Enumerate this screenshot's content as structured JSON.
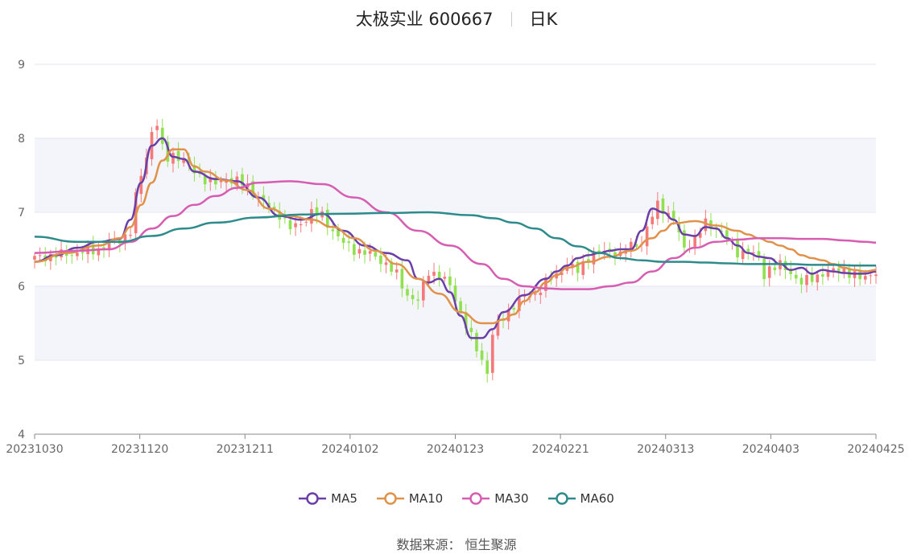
{
  "title": {
    "name": "太极实业 600667",
    "period": "日K"
  },
  "source": {
    "label": "数据来源：",
    "value": "恒生聚源"
  },
  "colors": {
    "up": "#f47a7a",
    "down": "#90e050",
    "grid_band": "#f4f5fb",
    "axis": "#666666"
  },
  "chart_data": {
    "type": "candlestick",
    "title": "太极实业 600667 日K",
    "ylim": [
      4,
      9
    ],
    "y_ticks": [
      4,
      5,
      6,
      7,
      8,
      9
    ],
    "x_tick_labels": [
      "20231030",
      "20231120",
      "20231211",
      "20240102",
      "20240123",
      "20240221",
      "20240313",
      "20240403",
      "20240425"
    ],
    "legend_position": "bottom",
    "series": [
      {
        "name": "MA5",
        "color": "#6a3fa8",
        "x": [
          0,
          4,
          8,
          12,
          16,
          18,
          20,
          22,
          24,
          26,
          28,
          30,
          34,
          38,
          42,
          46,
          50,
          54,
          58,
          62,
          66,
          70,
          72,
          74,
          76,
          78,
          80,
          82,
          84,
          86,
          88,
          92,
          96,
          98,
          100,
          102,
          104,
          106,
          108,
          110,
          112,
          114,
          116,
          118,
          120,
          122,
          124,
          126,
          128,
          130,
          132,
          134,
          136,
          138,
          140,
          142,
          144,
          146,
          148,
          150,
          152,
          154,
          156,
          158
        ],
        "values": [
          6.33,
          6.42,
          6.52,
          6.6,
          6.64,
          6.9,
          7.4,
          7.9,
          8.0,
          7.75,
          7.72,
          7.55,
          7.45,
          7.42,
          7.2,
          6.95,
          6.9,
          6.98,
          6.75,
          6.55,
          6.45,
          6.35,
          6.1,
          6.05,
          6.1,
          5.92,
          5.6,
          5.3,
          5.3,
          5.42,
          5.65,
          5.88,
          6.1,
          6.2,
          6.28,
          6.38,
          6.42,
          6.45,
          6.48,
          6.5,
          6.5,
          6.75,
          7.05,
          7.0,
          6.9,
          6.7,
          6.68,
          6.8,
          6.78,
          6.65,
          6.55,
          6.45,
          6.4,
          6.38,
          6.3,
          6.22,
          6.25,
          6.17,
          6.22,
          6.2,
          6.18,
          6.17,
          6.17,
          6.2
        ]
      },
      {
        "name": "MA10",
        "color": "#e0924a",
        "x": [
          0,
          6,
          12,
          16,
          18,
          20,
          22,
          24,
          26,
          28,
          30,
          32,
          36,
          40,
          44,
          48,
          52,
          56,
          60,
          64,
          68,
          72,
          76,
          80,
          84,
          86,
          88,
          90,
          92,
          94,
          96,
          98,
          100,
          104,
          108,
          112,
          116,
          118,
          120,
          124,
          128,
          132,
          134,
          136,
          138,
          140,
          142,
          144,
          146,
          148,
          150,
          152,
          154,
          156,
          158
        ],
        "values": [
          6.33,
          6.45,
          6.55,
          6.65,
          6.8,
          7.1,
          7.4,
          7.7,
          7.85,
          7.85,
          7.62,
          7.55,
          7.43,
          7.3,
          7.05,
          6.95,
          6.9,
          6.8,
          6.65,
          6.48,
          6.3,
          6.1,
          5.9,
          5.65,
          5.5,
          5.5,
          5.55,
          5.62,
          5.8,
          5.92,
          6.05,
          6.15,
          6.25,
          6.33,
          6.4,
          6.48,
          6.65,
          6.75,
          6.85,
          6.88,
          6.82,
          6.75,
          6.7,
          6.65,
          6.6,
          6.55,
          6.5,
          6.42,
          6.38,
          6.35,
          6.3,
          6.25,
          6.22,
          6.2,
          6.22
        ]
      },
      {
        "name": "MA30",
        "color": "#d65db1",
        "x": [
          0,
          8,
          14,
          18,
          22,
          26,
          30,
          34,
          38,
          42,
          48,
          54,
          60,
          66,
          72,
          78,
          84,
          88,
          92,
          96,
          100,
          104,
          108,
          112,
          116,
          120,
          124,
          128,
          132,
          136,
          140,
          144,
          148,
          152,
          156,
          158
        ],
        "values": [
          6.45,
          6.48,
          6.5,
          6.6,
          6.78,
          6.95,
          7.1,
          7.22,
          7.33,
          7.4,
          7.42,
          7.38,
          7.2,
          7.0,
          6.75,
          6.55,
          6.3,
          6.1,
          6.0,
          5.97,
          5.96,
          5.96,
          6.0,
          6.05,
          6.2,
          6.38,
          6.52,
          6.6,
          6.63,
          6.65,
          6.65,
          6.64,
          6.64,
          6.62,
          6.6,
          6.59
        ]
      },
      {
        "name": "MA60",
        "color": "#2e8b8b",
        "x": [
          0,
          8,
          16,
          22,
          28,
          34,
          42,
          50,
          58,
          66,
          74,
          82,
          86,
          90,
          94,
          98,
          102,
          106,
          110,
          114,
          118,
          122,
          126,
          130,
          134,
          138,
          142,
          146,
          150,
          154,
          158
        ],
        "values": [
          6.67,
          6.6,
          6.6,
          6.68,
          6.78,
          6.86,
          6.93,
          6.97,
          6.98,
          6.99,
          7.0,
          6.96,
          6.92,
          6.86,
          6.78,
          6.65,
          6.54,
          6.45,
          6.38,
          6.35,
          6.33,
          6.33,
          6.32,
          6.31,
          6.3,
          6.3,
          6.3,
          6.29,
          6.29,
          6.28,
          6.28
        ]
      }
    ],
    "candles": {
      "count": 159,
      "anchors": [
        [
          0,
          6.38
        ],
        [
          4,
          6.42
        ],
        [
          8,
          6.45
        ],
        [
          12,
          6.5
        ],
        [
          14,
          6.58
        ],
        [
          16,
          6.62
        ],
        [
          18,
          6.75
        ],
        [
          19,
          7.2
        ],
        [
          20,
          7.5
        ],
        [
          21,
          7.75
        ],
        [
          22,
          8.1
        ],
        [
          23,
          8.2
        ],
        [
          24,
          7.85
        ],
        [
          25,
          7.72
        ],
        [
          26,
          7.78
        ],
        [
          27,
          7.75
        ],
        [
          28,
          7.7
        ],
        [
          30,
          7.55
        ],
        [
          32,
          7.45
        ],
        [
          34,
          7.38
        ],
        [
          36,
          7.45
        ],
        [
          38,
          7.42
        ],
        [
          40,
          7.35
        ],
        [
          42,
          7.2
        ],
        [
          44,
          7.05
        ],
        [
          46,
          6.98
        ],
        [
          48,
          6.78
        ],
        [
          50,
          6.85
        ],
        [
          52,
          7.0
        ],
        [
          54,
          6.95
        ],
        [
          56,
          6.75
        ],
        [
          58,
          6.58
        ],
        [
          60,
          6.5
        ],
        [
          62,
          6.45
        ],
        [
          64,
          6.4
        ],
        [
          66,
          6.3
        ],
        [
          68,
          6.15
        ],
        [
          70,
          5.88
        ],
        [
          72,
          5.8
        ],
        [
          74,
          6.2
        ],
        [
          76,
          6.15
        ],
        [
          78,
          6.0
        ],
        [
          80,
          5.65
        ],
        [
          82,
          5.3
        ],
        [
          84,
          5.0
        ],
        [
          85,
          4.85
        ],
        [
          86,
          5.35
        ],
        [
          88,
          5.58
        ],
        [
          90,
          5.75
        ],
        [
          92,
          5.85
        ],
        [
          94,
          5.9
        ],
        [
          96,
          6.05
        ],
        [
          98,
          6.15
        ],
        [
          100,
          6.3
        ],
        [
          102,
          6.2
        ],
        [
          104,
          6.4
        ],
        [
          106,
          6.45
        ],
        [
          108,
          6.48
        ],
        [
          110,
          6.42
        ],
        [
          112,
          6.55
        ],
        [
          114,
          6.6
        ],
        [
          116,
          6.95
        ],
        [
          117,
          7.1
        ],
        [
          118,
          7.05
        ],
        [
          120,
          6.9
        ],
        [
          122,
          6.5
        ],
        [
          124,
          6.65
        ],
        [
          126,
          6.85
        ],
        [
          127,
          6.8
        ],
        [
          128,
          6.8
        ],
        [
          130,
          6.65
        ],
        [
          132,
          6.45
        ],
        [
          134,
          6.5
        ],
        [
          136,
          6.35
        ],
        [
          137,
          6.15
        ],
        [
          138,
          6.25
        ],
        [
          140,
          6.28
        ],
        [
          142,
          6.18
        ],
        [
          144,
          6.05
        ],
        [
          146,
          6.1
        ],
        [
          148,
          6.18
        ],
        [
          152,
          6.22
        ],
        [
          155,
          6.1
        ],
        [
          158,
          6.2
        ]
      ]
    }
  },
  "legend": [
    {
      "label": "MA5",
      "color": "#6a3fa8"
    },
    {
      "label": "MA10",
      "color": "#e0924a"
    },
    {
      "label": "MA30",
      "color": "#d65db1"
    },
    {
      "label": "MA60",
      "color": "#2e8b8b"
    }
  ]
}
